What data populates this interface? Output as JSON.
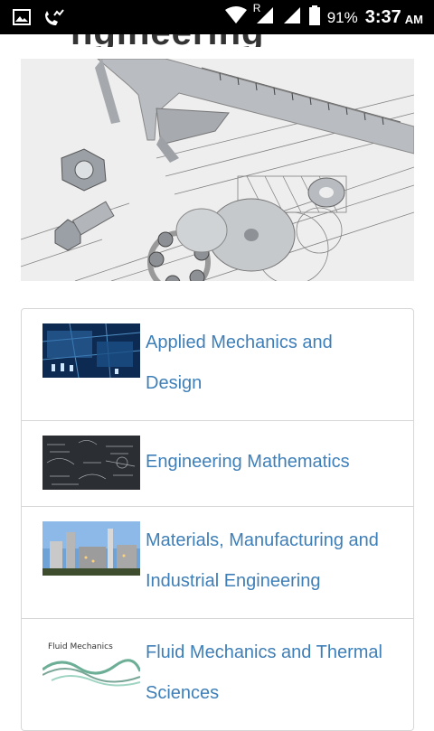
{
  "status_bar": {
    "roaming": "R",
    "battery_percent": "91%",
    "time": "3:37",
    "ampm": "AM",
    "icons": [
      "image-icon",
      "missed-call-icon",
      "wifi-icon",
      "signal-roaming-icon",
      "signal-icon",
      "battery-icon"
    ]
  },
  "page": {
    "heading_fragment": "ngineering"
  },
  "hero": {
    "alt_icon": "engineering-tools-image"
  },
  "categories": [
    {
      "label": "Applied Mechanics and Design",
      "thumb": "design-thumbnail"
    },
    {
      "label": "Engineering Mathematics",
      "thumb": "mathematics-thumbnail"
    },
    {
      "label": "Materials, Manufacturing and Industrial Engineering",
      "thumb": "factory-thumbnail"
    },
    {
      "label": "Fluid Mechanics and Thermal Sciences",
      "thumb": "fluid-mechanics-thumbnail",
      "thumb_caption": "Fluid Mechanics"
    }
  ]
}
